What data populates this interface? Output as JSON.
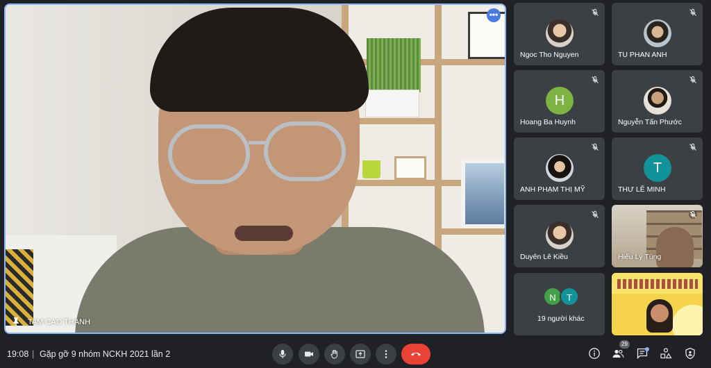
{
  "meeting": {
    "time": "19:08",
    "separator": "|",
    "title": "Gặp gỡ 9 nhóm NCKH 2021 lần 2"
  },
  "main_speaker": {
    "name": "TAM CAO THANH",
    "more_label": "•••"
  },
  "participants": [
    {
      "name": "Ngoc Tho Nguyen",
      "avatar": "photo",
      "muted": true
    },
    {
      "name": "TU PHAN ANH",
      "avatar": "photo",
      "muted": true
    },
    {
      "name": "Hoang Ba Huynh",
      "avatar": "letter",
      "letter": "H",
      "color": "#7cb342",
      "muted": true
    },
    {
      "name": "Nguyễn Tấn Phước",
      "avatar": "photo",
      "muted": true
    },
    {
      "name": "ANH PHẠM THỊ MỸ",
      "avatar": "photo",
      "muted": true
    },
    {
      "name": "THƯ LÊ MINH",
      "avatar": "letter",
      "letter": "T",
      "color": "#12939a",
      "muted": true
    },
    {
      "name": "Duyên Lê Kiều",
      "avatar": "photo",
      "muted": true
    },
    {
      "name": "Hiếu Lý Tùng",
      "avatar": "video",
      "muted": true
    },
    {
      "name": "19 người khác",
      "avatar": "group",
      "letters": [
        "N",
        "T"
      ],
      "colors": [
        "#43a047",
        "#12939a"
      ]
    },
    {
      "name": "",
      "avatar": "presentation"
    }
  ],
  "controls": {
    "participants_count": "29",
    "icons": [
      "mic-icon",
      "camera-icon",
      "raise-hand-icon",
      "present-icon",
      "more-options-icon",
      "end-call-icon",
      "info-icon",
      "people-icon",
      "chat-icon",
      "activities-icon",
      "host-controls-icon"
    ]
  },
  "colors": {
    "background": "#202124",
    "tile": "#3c4043",
    "accent": "#8ab4f8",
    "end_call": "#ea4335"
  }
}
